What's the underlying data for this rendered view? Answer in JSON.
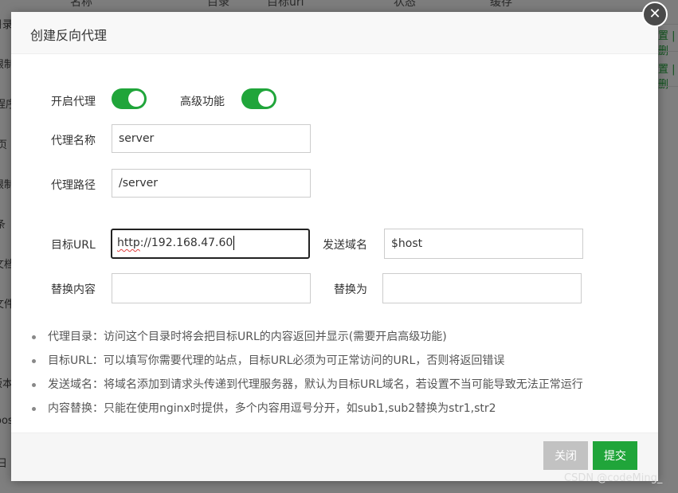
{
  "background": {
    "columns": [
      "名称",
      "目录",
      "目标url",
      "状态",
      "缓存"
    ],
    "sidebar_fragments": [
      "目录",
      "限制",
      "程序",
      "页",
      "限制",
      "条",
      "文档",
      "文件",
      "版本",
      "oos",
      "日"
    ],
    "links": [
      "置 | 删",
      "置 | 删"
    ]
  },
  "dialog": {
    "title": "创建反向代理",
    "close_symbol": "✕",
    "enable_proxy_label": "开启代理",
    "enable_proxy_on": true,
    "advanced_label": "高级功能",
    "advanced_on": true,
    "proxy_name_label": "代理名称",
    "proxy_name_value": "server",
    "proxy_path_label": "代理路径",
    "proxy_path_value": "/server",
    "target_url_label": "目标URL",
    "target_url_value_underlined": "http",
    "target_url_value_rest": "://192.168.47.60",
    "send_domain_label": "发送域名",
    "send_domain_value": "$host",
    "replace_content_label": "替换内容",
    "replace_content_value": "",
    "replace_with_label": "替换为",
    "replace_with_value": "",
    "notes": [
      "代理目录：访问这个目录时将会把目标URL的内容返回并显示(需要开启高级功能)",
      "目标URL：可以填写你需要代理的站点，目标URL必须为可正常访问的URL，否则将返回错误",
      "发送域名：将域名添加到请求头传递到代理服务器，默认为目标URL域名，若设置不当可能导致无法正常运行",
      "内容替换：只能在使用nginx时提供，多个内容用逗号分开，如sub1,sub2替换为str1,str2"
    ],
    "cancel_label": "关闭",
    "submit_label": "提交"
  },
  "watermark": "CSDN @codeMing_",
  "colors": {
    "accent": "#20a53a",
    "disabled": "#c2c2c2",
    "overlay": "rgba(0,0,0,0.5)"
  }
}
